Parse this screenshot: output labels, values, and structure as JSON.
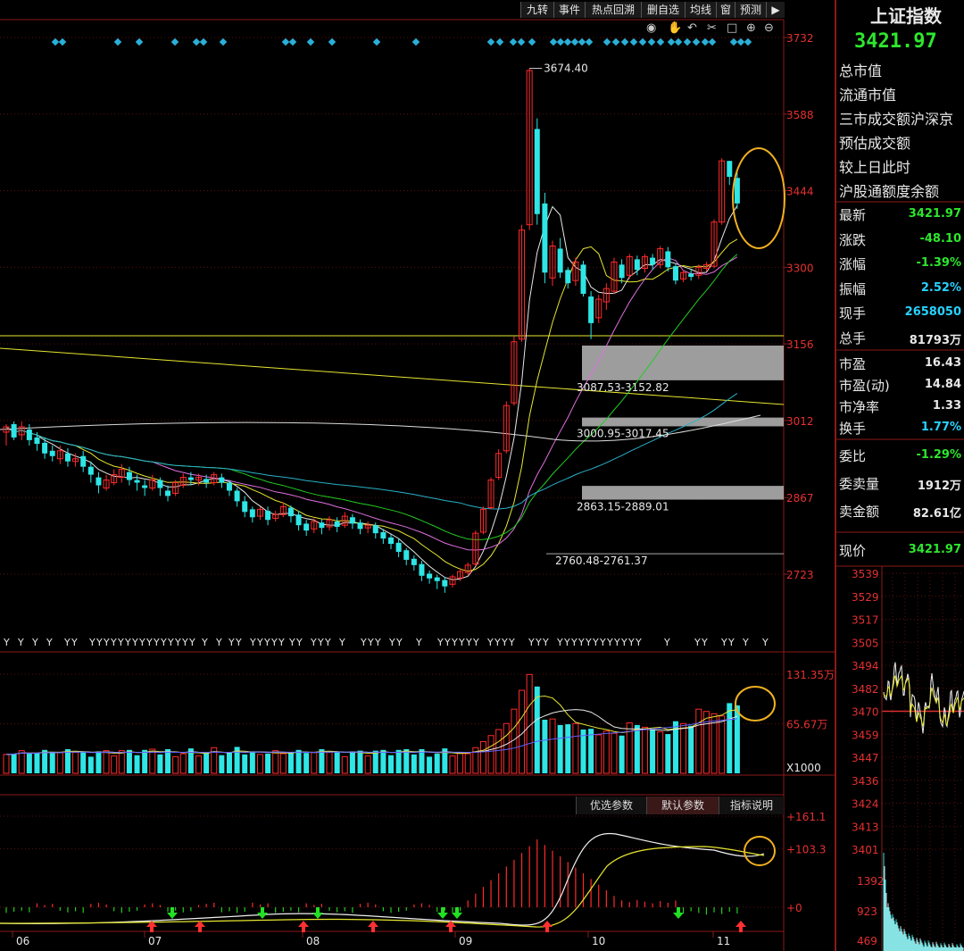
{
  "toolbar": {
    "buttons": [
      "九转",
      "事件",
      "热点回溯",
      "删自选",
      "均线",
      "窗",
      "预测"
    ]
  },
  "index": {
    "name": "上证指数",
    "value": "3421.97"
  },
  "info_labels": [
    "总市值",
    "流通市值",
    "三市成交额沪深京",
    "预估成交额",
    "较上日此时",
    "沪股通额度余额"
  ],
  "quote_rows": [
    {
      "label": "最新",
      "value": "3421.97",
      "color": "#2ee62e"
    },
    {
      "label": "涨跌",
      "value": "-48.10",
      "color": "#2ee62e"
    },
    {
      "label": "涨幅",
      "value": "-1.39%",
      "color": "#2ee62e"
    },
    {
      "label": "振幅",
      "value": "2.52%",
      "color": "#28d2ff"
    },
    {
      "label": "现手",
      "value": "2658050",
      "color": "#28d2ff"
    },
    {
      "label": "总手",
      "value": "81793万",
      "color": "#e8e8e8"
    }
  ],
  "valuation_rows": [
    {
      "label": "市盈",
      "value": "16.43",
      "color": "#e8e8e8"
    },
    {
      "label": "市盈(动)",
      "value": "14.84",
      "color": "#e8e8e8"
    },
    {
      "label": "市净率",
      "value": "1.33",
      "color": "#e8e8e8"
    },
    {
      "label": "换手",
      "value": "1.77%",
      "color": "#28d2ff"
    }
  ],
  "order_rows": [
    {
      "label": "委比",
      "value": "-1.29%",
      "color": "#2ee62e"
    },
    {
      "label": "委卖量",
      "value": "1912万",
      "color": "#e8e8e8"
    },
    {
      "label": "卖金额",
      "value": "82.61亿",
      "color": "#e8e8e8"
    }
  ],
  "current_price": {
    "label": "现价",
    "value": "3421.97"
  },
  "indicator_tabs": [
    "优选参数",
    "默认参数",
    "指标说明"
  ],
  "colors": {
    "up": "#ff2a2a",
    "down": "#2ee6e6",
    "frame": "#8b1a1a",
    "ma5": "#e8e8e8",
    "ma10": "#e6e630",
    "ma20": "#e070e0",
    "ma30": "#22cc22",
    "ma60": "#2ab0c8",
    "ma120": "#e6e630",
    "ma250": "#dddddd"
  },
  "chart_data": [
    {
      "type": "candlestick",
      "y_ticks": [
        "3732",
        "3588",
        "3444",
        "3300",
        "3156",
        "3012",
        "2867",
        "2723"
      ],
      "ylim": [
        2655,
        3740
      ],
      "x_ticks": [
        "06",
        "07",
        "08",
        "09",
        "10",
        "11"
      ],
      "peak_label": "3674.40",
      "gap_zones": [
        {
          "from": 3152.82,
          "to": 3087.53,
          "label": "3087.53-3152.82"
        },
        {
          "from": 3017.45,
          "to": 3000.95,
          "label": "3000.95-3017.45"
        },
        {
          "from": 2889.01,
          "to": 2863.15,
          "label": "2863.15-2889.01"
        }
      ],
      "support_line": {
        "value": 2761.37,
        "label": "2760.48-2761.37"
      },
      "candles_estimated": [
        [
          2990,
          3000,
          2965,
          3005
        ],
        [
          3005,
          2980,
          2975,
          3010
        ],
        [
          2985,
          3000,
          2975,
          3010
        ],
        [
          2995,
          2975,
          2965,
          3005
        ],
        [
          2980,
          2968,
          2955,
          2990
        ],
        [
          2970,
          2950,
          2940,
          2980
        ],
        [
          2955,
          2945,
          2935,
          2965
        ],
        [
          2940,
          2955,
          2930,
          2965
        ],
        [
          2950,
          2935,
          2925,
          2960
        ],
        [
          2935,
          2940,
          2925,
          2950
        ],
        [
          2945,
          2925,
          2915,
          2955
        ],
        [
          2925,
          2910,
          2895,
          2935
        ],
        [
          2905,
          2890,
          2875,
          2915
        ],
        [
          2885,
          2900,
          2880,
          2910
        ],
        [
          2895,
          2910,
          2890,
          2920
        ],
        [
          2905,
          2920,
          2895,
          2930
        ],
        [
          2915,
          2900,
          2890,
          2925
        ],
        [
          2900,
          2895,
          2880,
          2910
        ],
        [
          2890,
          2885,
          2870,
          2900
        ],
        [
          2885,
          2900,
          2880,
          2910
        ],
        [
          2900,
          2885,
          2870,
          2905
        ],
        [
          2880,
          2870,
          2860,
          2890
        ],
        [
          2875,
          2895,
          2870,
          2900
        ],
        [
          2890,
          2905,
          2885,
          2912
        ],
        [
          2905,
          2900,
          2890,
          2915
        ],
        [
          2900,
          2905,
          2890,
          2912
        ],
        [
          2902,
          2895,
          2885,
          2910
        ],
        [
          2895,
          2910,
          2890,
          2915
        ],
        [
          2905,
          2895,
          2885,
          2912
        ],
        [
          2895,
          2880,
          2870,
          2900
        ],
        [
          2880,
          2860,
          2850,
          2885
        ],
        [
          2860,
          2840,
          2830,
          2870
        ],
        [
          2845,
          2830,
          2820,
          2850
        ],
        [
          2832,
          2845,
          2825,
          2850
        ],
        [
          2842,
          2825,
          2815,
          2850
        ],
        [
          2828,
          2835,
          2822,
          2842
        ],
        [
          2835,
          2850,
          2830,
          2858
        ],
        [
          2848,
          2832,
          2820,
          2852
        ],
        [
          2835,
          2815,
          2805,
          2842
        ],
        [
          2818,
          2805,
          2795,
          2825
        ],
        [
          2808,
          2822,
          2800,
          2828
        ],
        [
          2820,
          2810,
          2798,
          2826
        ],
        [
          2812,
          2825,
          2805,
          2832
        ],
        [
          2822,
          2812,
          2802,
          2830
        ],
        [
          2815,
          2832,
          2810,
          2840
        ],
        [
          2830,
          2818,
          2808,
          2836
        ],
        [
          2820,
          2808,
          2798,
          2826
        ],
        [
          2810,
          2815,
          2800,
          2822
        ],
        [
          2815,
          2800,
          2790,
          2820
        ],
        [
          2802,
          2790,
          2780,
          2808
        ],
        [
          2792,
          2780,
          2770,
          2798
        ],
        [
          2782,
          2765,
          2755,
          2790
        ],
        [
          2768,
          2750,
          2740,
          2772
        ],
        [
          2752,
          2740,
          2730,
          2758
        ],
        [
          2742,
          2720,
          2710,
          2748
        ],
        [
          2724,
          2715,
          2705,
          2730
        ],
        [
          2717,
          2710,
          2695,
          2722
        ],
        [
          2712,
          2700,
          2688,
          2718
        ],
        [
          2704,
          2718,
          2698,
          2722
        ],
        [
          2716,
          2728,
          2710,
          2735
        ],
        [
          2726,
          2740,
          2720,
          2745
        ],
        [
          2742,
          2800,
          2738,
          2805
        ],
        [
          2802,
          2845,
          2798,
          2850
        ],
        [
          2848,
          2900,
          2845,
          2905
        ],
        [
          2905,
          2950,
          2900,
          2958
        ],
        [
          2955,
          3040,
          2950,
          3048
        ],
        [
          3045,
          3160,
          3040,
          3170
        ],
        [
          3165,
          3370,
          3160,
          3380
        ],
        [
          3380,
          3670,
          3370,
          3674
        ],
        [
          3560,
          3400,
          3380,
          3580
        ],
        [
          3420,
          3290,
          3270,
          3440
        ],
        [
          3280,
          3340,
          3265,
          3350
        ],
        [
          3335,
          3290,
          3280,
          3355
        ],
        [
          3295,
          3270,
          3260,
          3300
        ],
        [
          3275,
          3310,
          3265,
          3318
        ],
        [
          3305,
          3250,
          3245,
          3312
        ],
        [
          3245,
          3195,
          3165,
          3255
        ],
        [
          3205,
          3240,
          3195,
          3248
        ],
        [
          3235,
          3260,
          3220,
          3270
        ],
        [
          3255,
          3310,
          3250,
          3318
        ],
        [
          3305,
          3280,
          3270,
          3315
        ],
        [
          3285,
          3320,
          3278,
          3325
        ],
        [
          3315,
          3295,
          3285,
          3322
        ],
        [
          3298,
          3320,
          3290,
          3325
        ],
        [
          3318,
          3305,
          3295,
          3325
        ],
        [
          3305,
          3335,
          3298,
          3340
        ],
        [
          3330,
          3300,
          3292,
          3338
        ],
        [
          3302,
          3275,
          3268,
          3308
        ],
        [
          3278,
          3290,
          3272,
          3295
        ],
        [
          3288,
          3282,
          3275,
          3295
        ],
        [
          3285,
          3300,
          3278,
          3305
        ],
        [
          3298,
          3305,
          3292,
          3310
        ],
        [
          3302,
          3385,
          3298,
          3390
        ],
        [
          3385,
          3500,
          3380,
          3505
        ],
        [
          3500,
          3470,
          3455,
          3500
        ],
        [
          3468,
          3420,
          3410,
          3480
        ]
      ]
    },
    {
      "type": "bar",
      "name": "volume",
      "y_ticks": [
        "131.35万",
        "65.67万"
      ],
      "unit_label": "X1000",
      "ylim": [
        0,
        131.35
      ]
    },
    {
      "type": "line",
      "name": "indicator",
      "y_ticks": [
        "+161.1",
        "+103.3",
        "+0"
      ]
    },
    {
      "type": "line",
      "name": "intraday",
      "y_ticks": [
        "3539",
        "3529",
        "3517",
        "3505",
        "3494",
        "3482",
        "3470",
        "3459",
        "3447",
        "3436",
        "3424",
        "3413",
        "3401"
      ],
      "volume_ticks": [
        "1392",
        "923",
        "469"
      ]
    }
  ]
}
